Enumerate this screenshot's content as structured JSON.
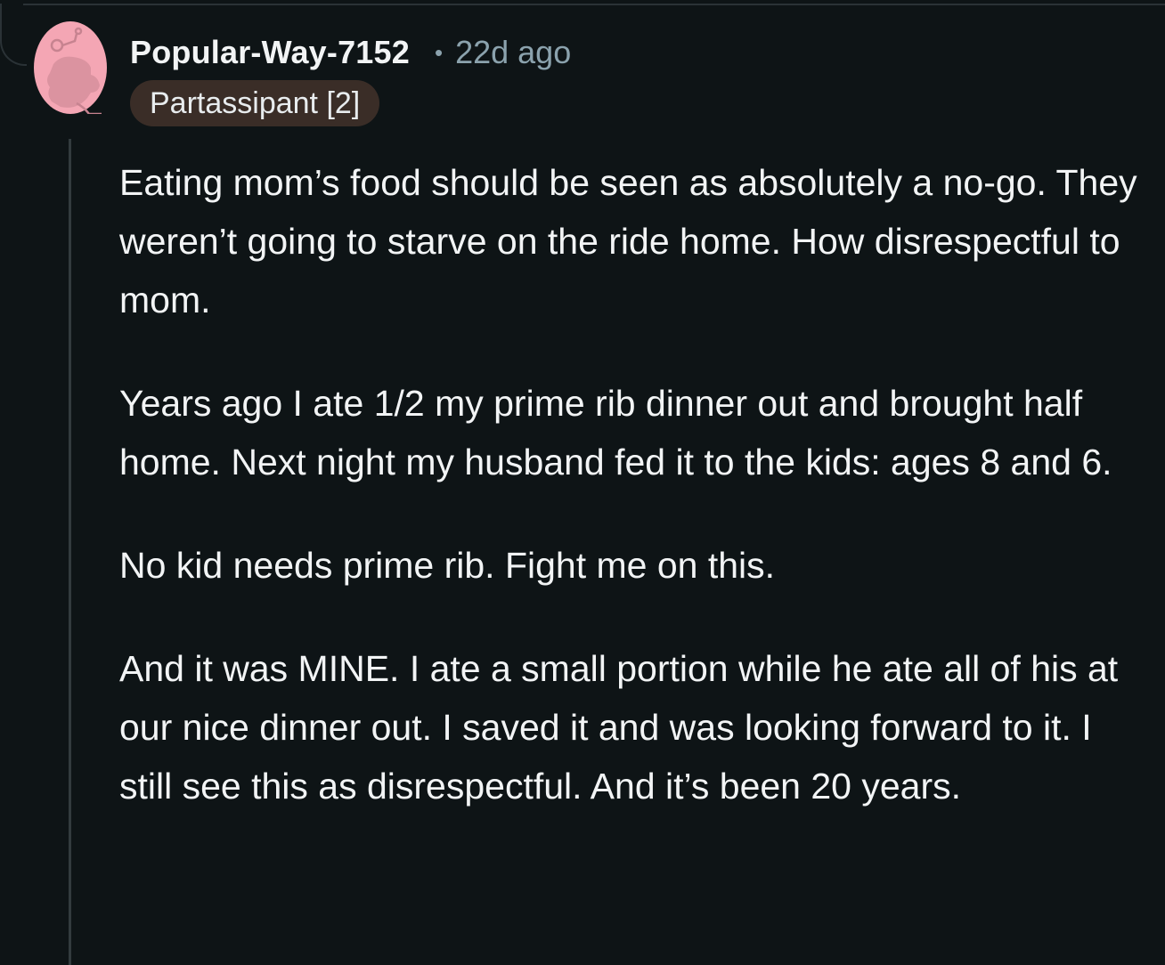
{
  "comment": {
    "username": "Popular-Way-7152",
    "separator": "•",
    "timestamp": "22d ago",
    "flair": "Partassipant [2]",
    "avatar_icon": "snoo-avatar-icon",
    "colors": {
      "background": "#0e1416",
      "text": "#f2f4f5",
      "meta": "#8ba2ad",
      "flair_bg": "#3a2d27",
      "avatar_bg": "#f4a6b4",
      "thread_line": "#333b3e"
    },
    "paragraphs": [
      "Eating mom’s food should be seen as absolutely a no-go. They weren’t going to starve on the ride home. How disrespectful to mom.",
      "Years ago I ate 1/2 my prime rib dinner out and brought half home. Next night my husband fed it to the kids: ages 8 and 6.",
      "No kid needs prime rib. Fight me on this.",
      "And it was MINE. I ate a small portion while he ate all of his at our nice dinner out. I saved it and was looking forward to it. I still see this as disrespectful. And it’s been 20 years."
    ]
  }
}
